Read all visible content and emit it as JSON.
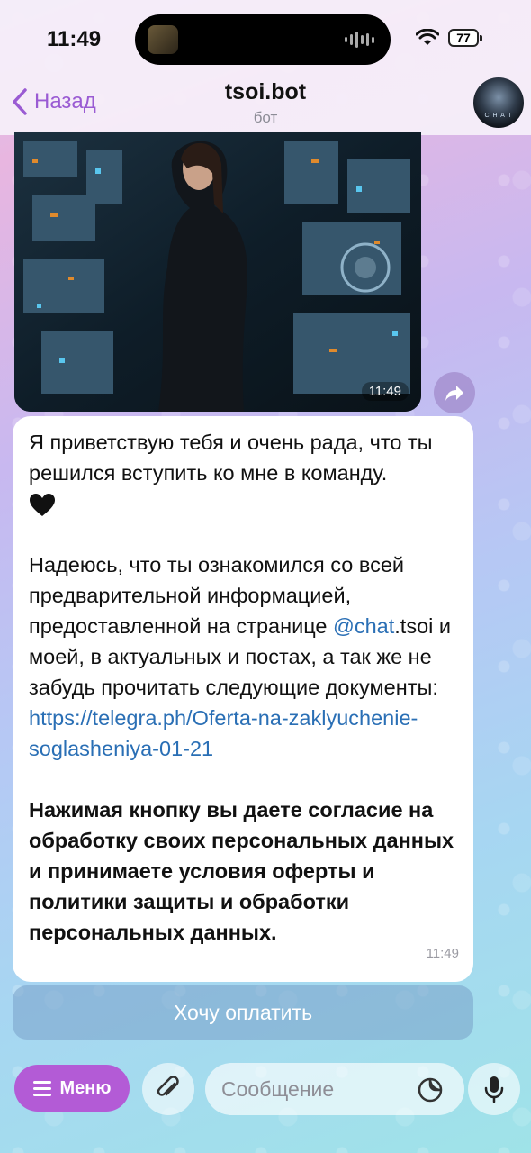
{
  "status_bar": {
    "time": "11:49",
    "battery": "77"
  },
  "header": {
    "back_label": "Назад",
    "title": "tsoi.bot",
    "subtitle": "бот",
    "avatar_text": "C H A T"
  },
  "image_message": {
    "time": "11:49"
  },
  "text_message": {
    "para1": "Я приветствую тебя и очень рада, что ты решился вступить ко мне в команду.",
    "para2_a": "Надеюсь, что ты ознакомился со всей предварительной информацией, предоставленной на странице ",
    "mention": "@chat",
    "para2_b": ".tsoi и моей, в актуальных и постах, а так же не забудь прочитать следующие документы: ",
    "link": "https://telegra.ph/Oferta-na-zaklyuchenie-soglasheniya-01-21",
    "para3": "Нажимая кнопку вы даете согласие на обработку своих персональных данных и принимаете условия оферты и политики защиты и обработки персональных данных.",
    "time": "11:49"
  },
  "inline_button": {
    "label": "Хочу оплатить"
  },
  "input_bar": {
    "menu_label": "Меню",
    "placeholder": "Сообщение"
  },
  "colors": {
    "accent": "#b35bd6",
    "link": "#2a6fb5",
    "back": "#9a5bd3"
  }
}
